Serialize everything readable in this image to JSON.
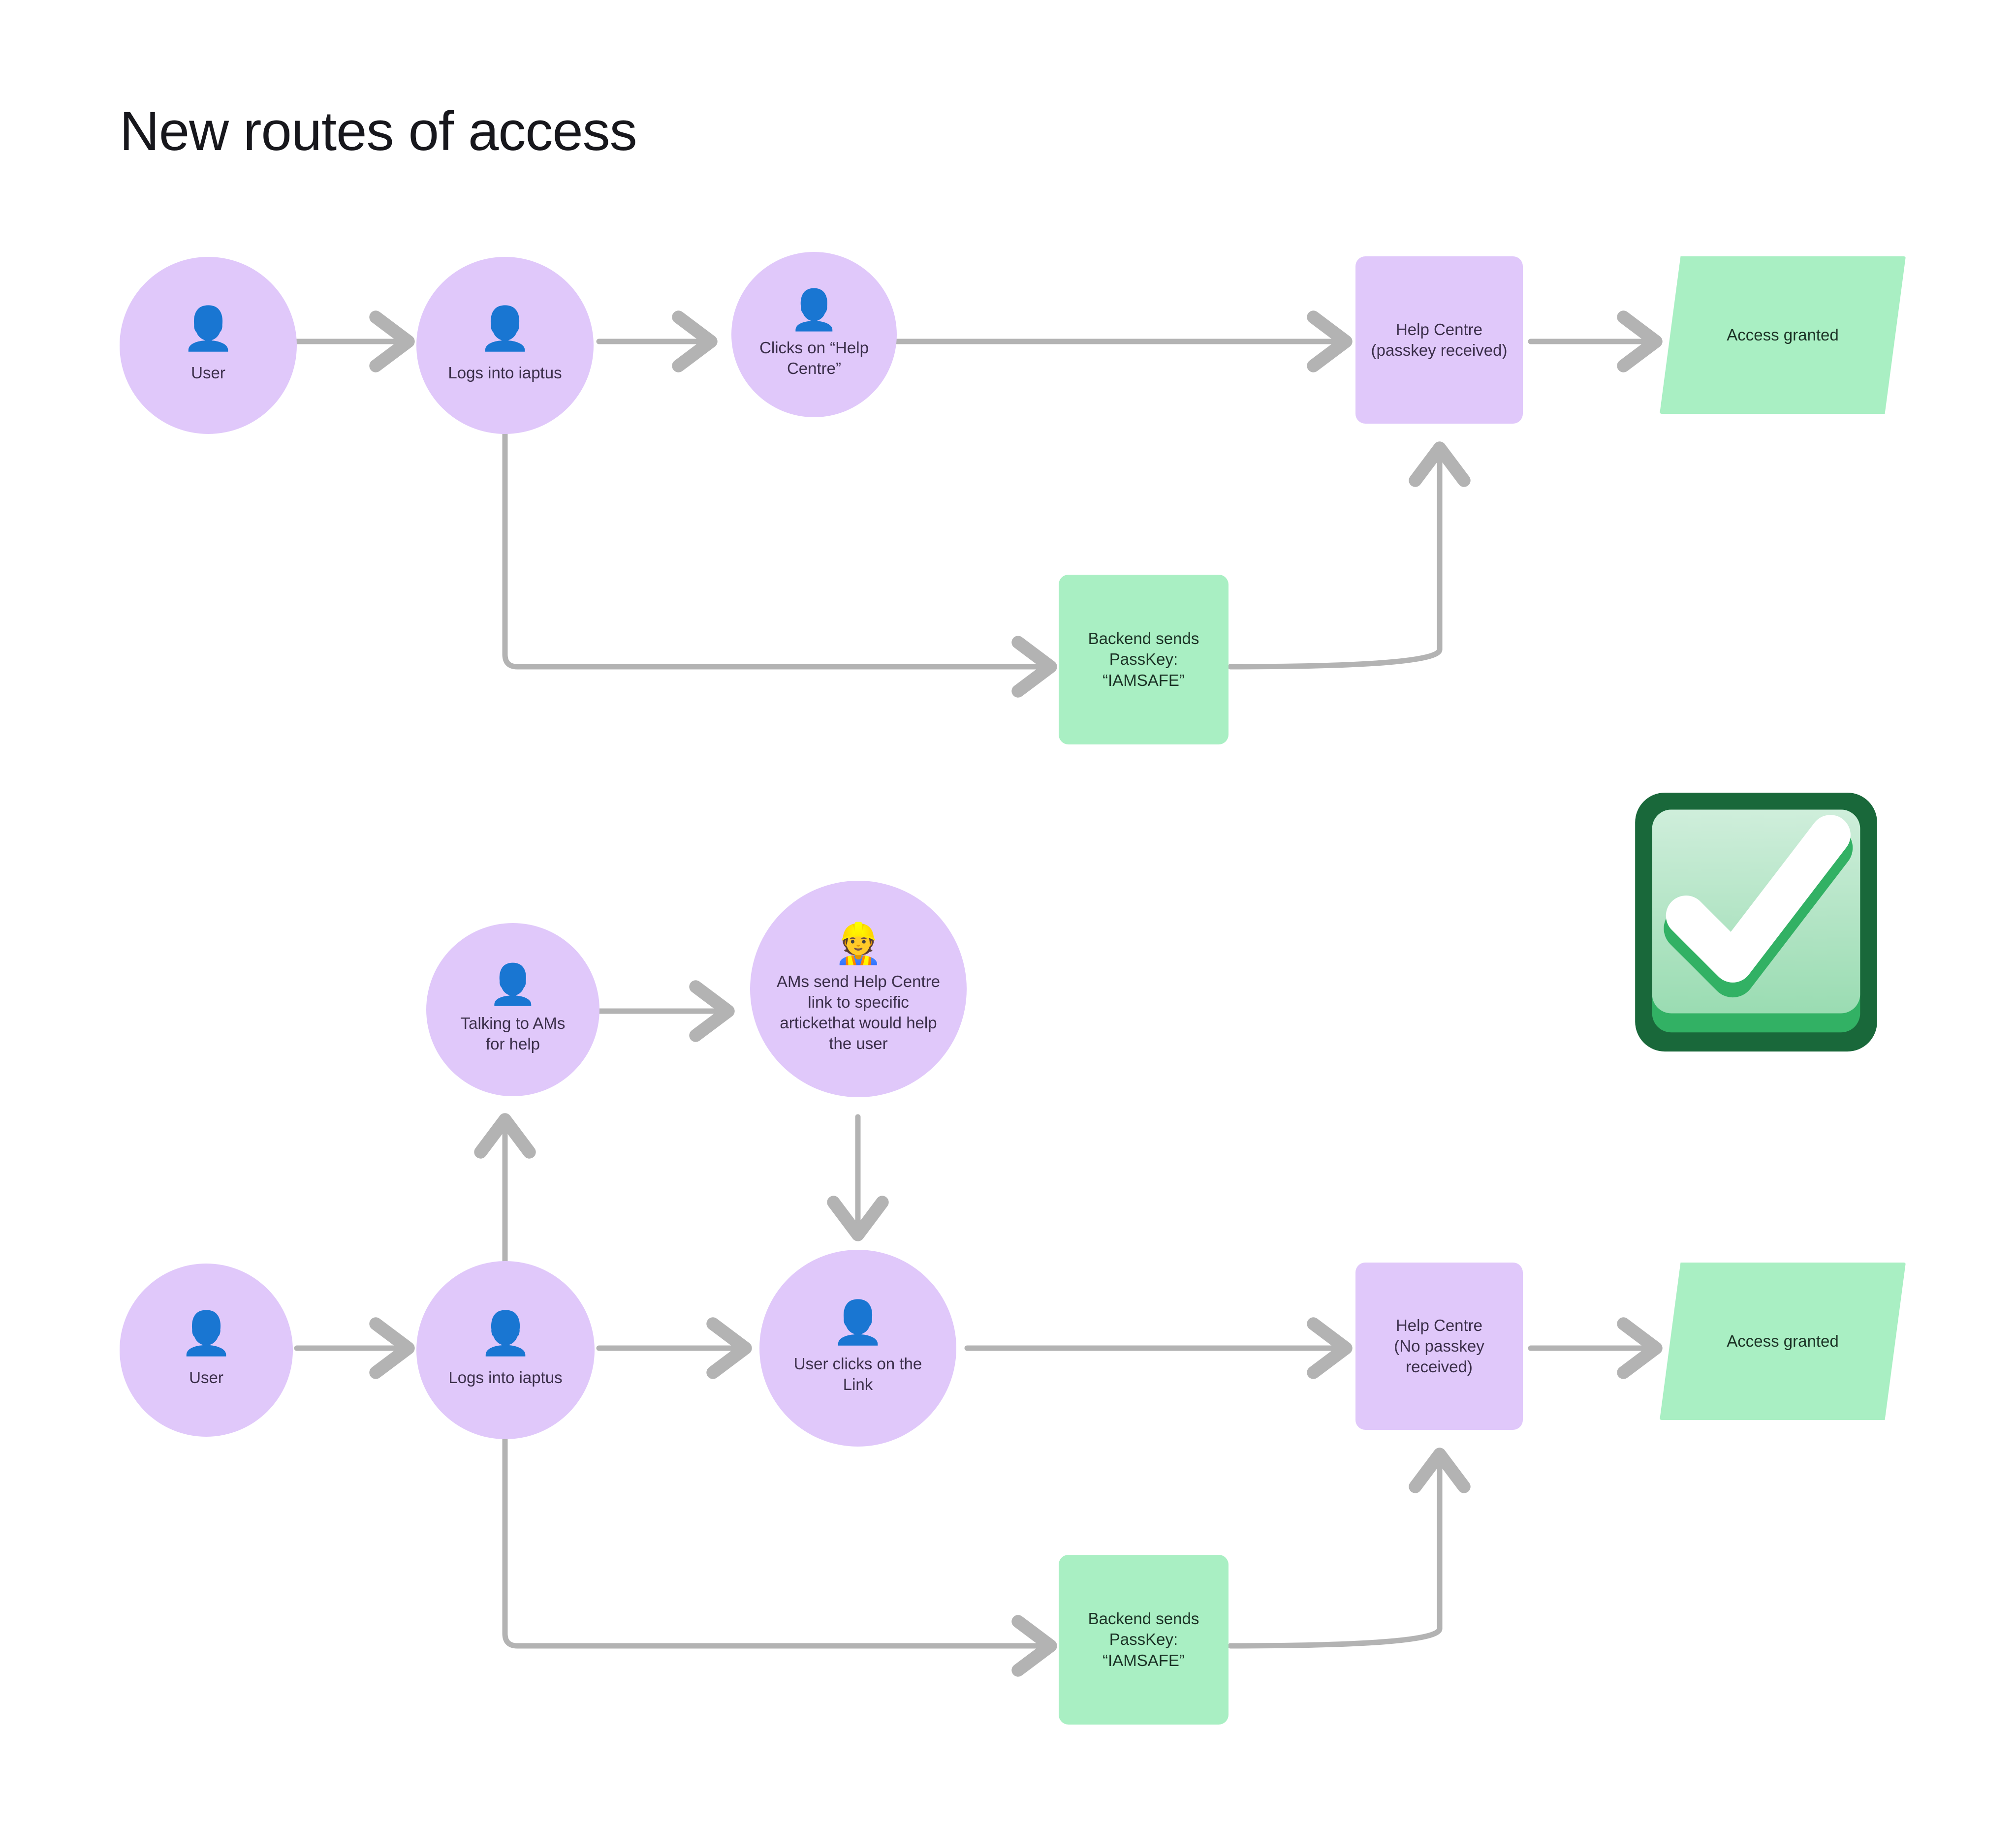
{
  "title": "New routes of access",
  "colors": {
    "node_purple": "#e0c8fa",
    "node_green": "#a9efc3",
    "edge_gray": "#b3b3b3",
    "title_text": "#17171c",
    "purple_text": "#3b2f4a",
    "green_text": "#1c3326",
    "check_border": "#19683a",
    "check_fill": "#a7e0bb",
    "check_mark": "#ffffff"
  },
  "flows": [
    {
      "id": "flow-passkey",
      "nodes": [
        {
          "id": "user-1",
          "shape": "circle",
          "icon": "person-icon",
          "emoji": "👤",
          "label": "User"
        },
        {
          "id": "login-1",
          "shape": "circle",
          "icon": "person-icon",
          "emoji": "👤",
          "label": "Logs into iaptus"
        },
        {
          "id": "click-help",
          "shape": "circle",
          "icon": "person-icon",
          "emoji": "👤",
          "label": "Clicks on “Help\nCentre”"
        },
        {
          "id": "backend-1",
          "shape": "rect-green",
          "icon": null,
          "emoji": null,
          "label": "Backend sends\nPassKey:\n“IAMSAFE”"
        },
        {
          "id": "helpcentre-1",
          "shape": "rect",
          "icon": null,
          "emoji": null,
          "label": "Help Centre\n(passkey received)"
        },
        {
          "id": "granted-1",
          "shape": "parallelogram",
          "icon": null,
          "emoji": null,
          "label": "Access granted"
        }
      ]
    },
    {
      "id": "flow-no-passkey",
      "nodes": [
        {
          "id": "talking-ams",
          "shape": "circle",
          "icon": "person-icon",
          "emoji": "👤",
          "label": "Talking to AMs\nfor help"
        },
        {
          "id": "ams-send-link",
          "shape": "circle",
          "icon": "construction-worker-icon",
          "emoji": "👷",
          "label": "AMs send Help Centre\nlink to specific\nartickethat would help\nthe user"
        },
        {
          "id": "user-2",
          "shape": "circle",
          "icon": "person-icon",
          "emoji": "👤",
          "label": "User"
        },
        {
          "id": "login-2",
          "shape": "circle",
          "icon": "person-icon",
          "emoji": "👤",
          "label": "Logs into iaptus"
        },
        {
          "id": "click-link",
          "shape": "circle",
          "icon": "person-icon",
          "emoji": "👤",
          "label": "User clicks on the\nLink"
        },
        {
          "id": "backend-2",
          "shape": "rect-green",
          "icon": null,
          "emoji": null,
          "label": "Backend sends\nPassKey:\n“IAMSAFE”"
        },
        {
          "id": "helpcentre-2",
          "shape": "rect",
          "icon": null,
          "emoji": null,
          "label": "Help Centre\n(No passkey\nreceived)"
        },
        {
          "id": "granted-2",
          "shape": "parallelogram",
          "icon": null,
          "emoji": null,
          "label": "Access granted"
        }
      ]
    }
  ],
  "badge": {
    "icon": "check-mark-box-icon",
    "label": ""
  }
}
